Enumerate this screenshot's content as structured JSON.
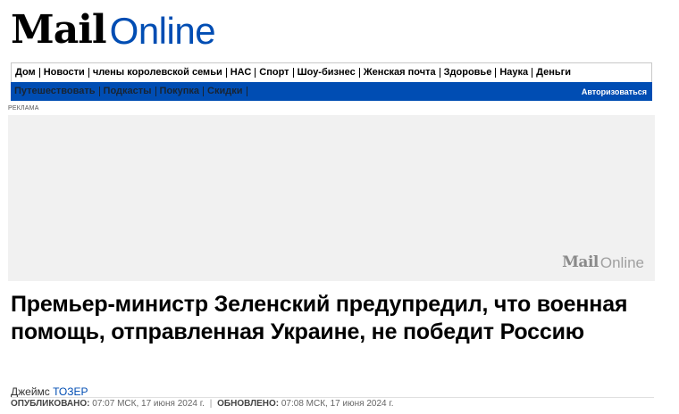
{
  "masthead": {
    "mail": "Mail",
    "online": "Online"
  },
  "nav": {
    "primary": [
      "Дом",
      "Новости",
      "члены королевской семьи",
      "НАС",
      "Спорт",
      "Шоу-бизнес",
      "Женская почта",
      "Здоровье",
      "Наука",
      "Деньги"
    ],
    "secondary": [
      "Путешествовать",
      "Подкасты",
      "Покупка",
      "Скидки"
    ],
    "login": "Авторизоваться",
    "colors": {
      "bar": "#004db3"
    }
  },
  "ad": {
    "label": "РЕКЛАМА",
    "logo_mail": "Mail",
    "logo_online": "Online"
  },
  "article": {
    "headline": "Премьер-министр Зеленский предупредил, что военная помощь, отправленная Украине, не победит Россию",
    "byline_prefix": "Джеймс",
    "byline_author": "ТОЗЕР",
    "published_label": "ОПУБЛИКОВАНО:",
    "published_value": "07:07 МСК, 17 июня 2024 г.",
    "separator": "|",
    "updated_label": "ОБНОВЛЕНО:",
    "updated_value": "07:08 МСК, 17 июня 2024 г."
  }
}
